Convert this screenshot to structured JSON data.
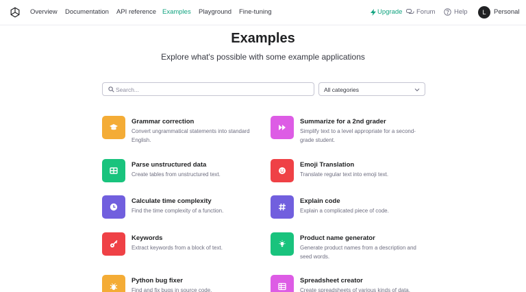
{
  "nav": {
    "links": [
      "Overview",
      "Documentation",
      "API reference",
      "Examples",
      "Playground",
      "Fine-tuning"
    ],
    "active": "Examples",
    "upgrade": "Upgrade",
    "forum": "Forum",
    "help": "Help",
    "avatar_initial": "L",
    "account": "Personal"
  },
  "header": {
    "title": "Examples",
    "subtitle": "Explore what's possible with some example applications"
  },
  "search": {
    "placeholder": "Search...",
    "value": ""
  },
  "category_filter": {
    "selected": "All categories"
  },
  "colors": {
    "accent": "#10a37f",
    "orange": "#f4a352",
    "magenta": "#dd5ce5",
    "green": "#19c37d",
    "red": "#ef4146",
    "purple": "#715fde",
    "violet": "#8e4ee5",
    "teal": "#19c37d"
  },
  "examples": [
    {
      "title": "Grammar correction",
      "description": "Convert ungrammatical statements into standard English.",
      "icon": "graduation-cap-icon",
      "color": "#f4ac36"
    },
    {
      "title": "Summarize for a 2nd grader",
      "description": "Simplify text to a level appropriate for a second-grade student.",
      "icon": "fast-forward-icon",
      "color": "#dd5ce5"
    },
    {
      "title": "Parse unstructured data",
      "description": "Create tables from unstructured text.",
      "icon": "table-icon",
      "color": "#19c37d"
    },
    {
      "title": "Emoji Translation",
      "description": "Translate regular text into emoji text.",
      "icon": "smiley-icon",
      "color": "#ef4146"
    },
    {
      "title": "Calculate time complexity",
      "description": "Find the time complexity of a function.",
      "icon": "clock-icon",
      "color": "#715fde"
    },
    {
      "title": "Explain code",
      "description": "Explain a complicated piece of code.",
      "icon": "hash-icon",
      "color": "#715fde"
    },
    {
      "title": "Keywords",
      "description": "Extract keywords from a block of text.",
      "icon": "key-icon",
      "color": "#ef4146"
    },
    {
      "title": "Product name generator",
      "description": "Generate product names from a description and seed words.",
      "icon": "lightbulb-icon",
      "color": "#19c37d"
    },
    {
      "title": "Python bug fixer",
      "description": "Find and fix bugs in source code.",
      "icon": "bug-icon",
      "color": "#f4ac36"
    },
    {
      "title": "Spreadsheet creator",
      "description": "Create spreadsheets of various kinds of data.",
      "icon": "spreadsheet-icon",
      "color": "#dd5ce5"
    }
  ]
}
